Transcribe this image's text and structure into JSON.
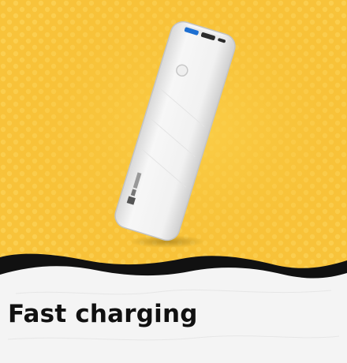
{
  "tile": {
    "caption": "Fast charging",
    "colors": {
      "background": "#f8c33a",
      "dots": "#fcd357",
      "wave_dark": "#111111",
      "paper": "#f4f4f4",
      "caption_text": "#111111"
    }
  },
  "product": {
    "name_icon": "power-bank-icon",
    "brand_mark": "portronics-logo",
    "colors": {
      "body": "#f2f2f2",
      "shade": "#d4d4d4",
      "port_accent": "#1e6fd1"
    }
  }
}
